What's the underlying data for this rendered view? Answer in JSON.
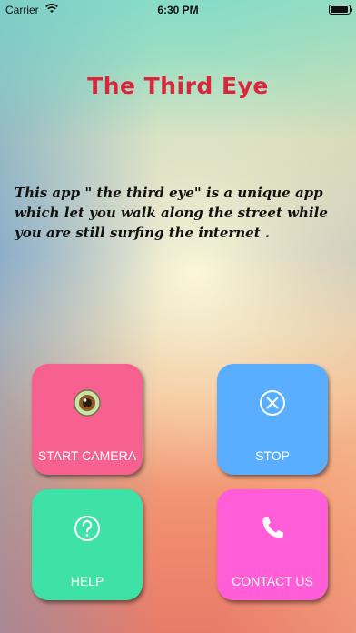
{
  "status_bar": {
    "carrier": "Carrier",
    "time": "6:30 PM"
  },
  "title": "The Third Eye",
  "description": "This app \" the third eye\" is a  unique app which let you walk along the street while you are still surfing the internet .",
  "tiles": [
    {
      "label": "START CAMERA",
      "color": "#f66190",
      "icon": "eye-icon"
    },
    {
      "label": "STOP",
      "color": "#5aaeff",
      "icon": "close-circle-icon"
    },
    {
      "label": "HELP",
      "color": "#3ee1a6",
      "icon": "question-circle-icon"
    },
    {
      "label": "CONTACT US",
      "color": "#ff5ed8",
      "icon": "phone-icon"
    }
  ]
}
